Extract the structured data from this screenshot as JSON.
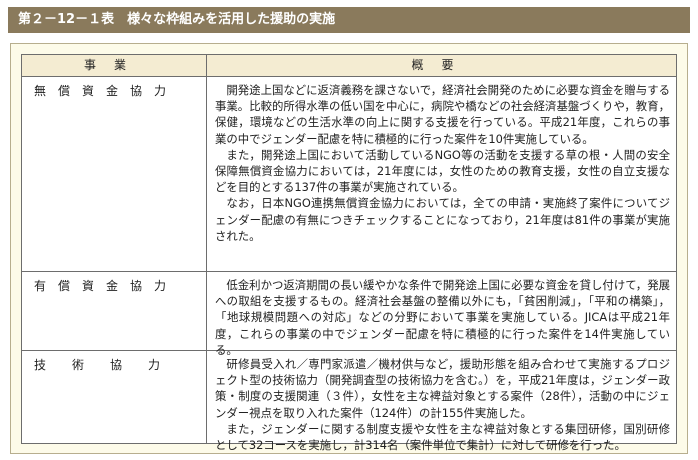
{
  "title": "第２－12－１表　様々な枠組みを活用した援助の実施",
  "header": {
    "col1": "事業",
    "col2": "概要"
  },
  "rows": [
    {
      "name": "無償資金協力",
      "paragraphs": [
        "開発途上国などに返済義務を課さないで，経済社会開発のために必要な資金を贈与する事業。比較的所得水準の低い国を中心に，病院や橋などの社会経済基盤づくりや，教育，保健，環境などの生活水準の向上に関する支援を行っている。平成21年度，これらの事業の中でジェンダー配慮を特に積極的に行った案件を10件実施している。",
        "また，開発途上国において活動しているNGO等の活動を支援する草の根・人間の安全保障無償資金協力においては，21年度には，女性のための教育支援，女性の自立支援などを目的とする137件の事業が実施されている。",
        "なお，日本NGO連携無償資金協力においては，全ての申請・実施終了案件についてジェンダー配慮の有無につきチェックすることになっており，21年度は81件の事業が実施された。"
      ]
    },
    {
      "name": "有償資金協力",
      "paragraphs": [
        "低金利かつ返済期間の長い緩やかな条件で開発途上国に必要な資金を貸し付けて，発展への取組を支援するもの。経済社会基盤の整備以外にも，「貧困削減」，「平和の構築」，「地球規模問題への対応」などの分野において事業を実施している。JICAは平成21年度，これらの事業の中でジェンダー配慮を特に積極的に行った案件を14件実施している。"
      ]
    },
    {
      "name": "技術協力",
      "paragraphs": [
        "研修員受入れ／専門家派遣／機材供与など，援助形態を組み合わせて実施するプロジェクト型の技術協力（開発調査型の技術協力を含む。）を，平成21年度は，ジェンダー政策・制度の支援関連（３件），女性を主な裨益対象とする案件（28件），活動の中にジェンダー視点を取り入れた案件（124件）の計155件実施した。",
        "また，ジェンダーに関する制度支援や女性を主な裨益対象とする集団研修，国別研修として32コースを実施し，計314名（案件単位で集計）に対して研修を行った。"
      ]
    }
  ]
}
